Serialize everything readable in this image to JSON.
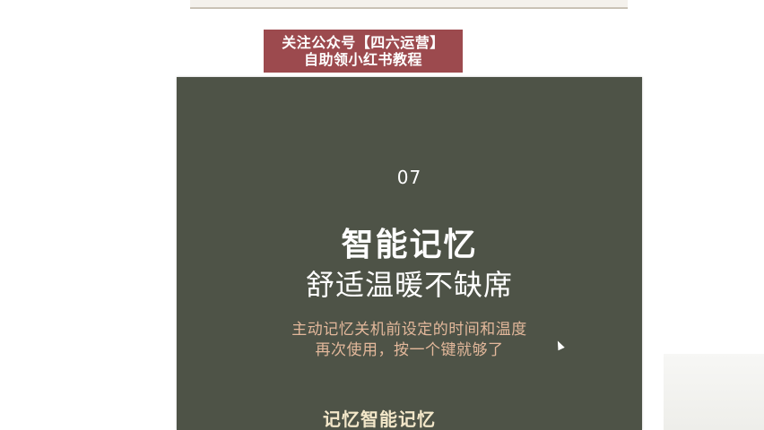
{
  "banner": {
    "line1": "关注公众号【四六运营】",
    "line2": "自助领小红书教程"
  },
  "slide": {
    "number": "07",
    "title": "智能记忆",
    "subtitle": "舒适温暖不缺席",
    "desc_line1": "主动记忆关机前设定的时间和温度",
    "desc_line2": "再次使用，按一个键就够了",
    "bottom_label": "记忆智能记忆"
  },
  "colors": {
    "slide_background": "#4e5347",
    "banner_background": "#9c4a4e",
    "desc_text": "#e3b89b"
  }
}
